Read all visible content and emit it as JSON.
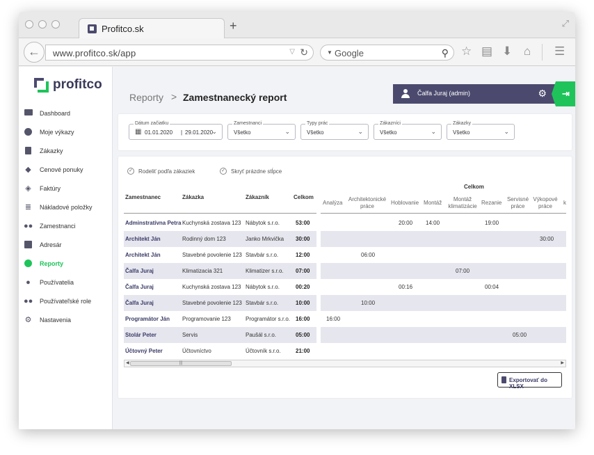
{
  "browser": {
    "tab_title": "Profitco.sk",
    "url": "www.profitco.sk/app",
    "search_placeholder": "Google"
  },
  "app": {
    "logo_text": "profitco",
    "sidebar": {
      "items": [
        {
          "label": "Dashboard",
          "icon": "dashboard-icon"
        },
        {
          "label": "Moje výkazy",
          "icon": "clock-icon"
        },
        {
          "label": "Zákazky",
          "icon": "document-icon"
        },
        {
          "label": "Cenové ponuky",
          "icon": "tag-icon"
        },
        {
          "label": "Faktúry",
          "icon": "layers-icon"
        },
        {
          "label": "Nákladové položky",
          "icon": "coins-icon"
        },
        {
          "label": "Zamestnanci",
          "icon": "users-icon"
        },
        {
          "label": "Adresár",
          "icon": "contact-book-icon"
        },
        {
          "label": "Reporty",
          "icon": "pie-chart-icon",
          "active": true
        },
        {
          "label": "Používatelia",
          "icon": "user-gear-icon"
        },
        {
          "label": "Používateľské role",
          "icon": "user-group-icon"
        },
        {
          "label": "Nastavenia",
          "icon": "gears-icon"
        }
      ]
    },
    "breadcrumb": {
      "parent": "Reporty",
      "separator": ">",
      "current": "Zamestnanecký report"
    },
    "user": {
      "name": "Čalfa Juraj (admin)"
    },
    "filters": {
      "date_label": "Dátum začiatku",
      "date_from": "01.01.2020",
      "date_to": "29.01.2020",
      "date_separator": "|",
      "employees_label": "Zamestnanci",
      "employees_value": "Všetko",
      "work_types_label": "Typy prác",
      "work_types_value": "Všetko",
      "customers_label": "Zákazníci",
      "customers_value": "Všetko",
      "orders_label": "Zákazky",
      "orders_value": "Všetko"
    },
    "options": {
      "split_by_order": "Rodeliť podľa zákaziek",
      "hide_empty": "Skryť prázdne stĺpce"
    },
    "table": {
      "headers": {
        "employee": "Zamestnanec",
        "order": "Zákazka",
        "customer": "Zákazník",
        "total": "Celkom",
        "group": "Celkom"
      },
      "work_columns": [
        "Analýza",
        "Architektonické práce",
        "Hoblovanie",
        "Montáž",
        "Montáž klimatizácie",
        "Rezanie",
        "Servisné práce",
        "Výkopové práce",
        "k"
      ],
      "rows": [
        {
          "employee": "Adminstratívna Petra",
          "order": "Kuchynská zostava 123",
          "customer": "Nábytok s.r.o.",
          "total": "53:00",
          "values": [
            "",
            "",
            "20:00",
            "14:00",
            "",
            "19:00",
            "",
            "",
            ""
          ]
        },
        {
          "employee": "Architekt Ján",
          "order": "Rodinný dom 123",
          "customer": "Janko Mrkvička",
          "total": "30:00",
          "values": [
            "",
            "",
            "",
            "",
            "",
            "",
            "",
            "30:00",
            ""
          ]
        },
        {
          "employee": "Architekt Ján",
          "order": "Stavebné povolenie 123",
          "customer": "Stavbár s.r.o.",
          "total": "12:00",
          "values": [
            "",
            "06:00",
            "",
            "",
            "",
            "",
            "",
            "",
            ""
          ]
        },
        {
          "employee": "Čalfa Juraj",
          "order": "Klimatizacia 321",
          "customer": "Klimatizer s.r.o.",
          "total": "07:00",
          "values": [
            "",
            "",
            "",
            "",
            "07:00",
            "",
            "",
            "",
            ""
          ]
        },
        {
          "employee": "Čalfa Juraj",
          "order": "Kuchynská zostava 123",
          "customer": "Nábytok s.r.o.",
          "total": "00:20",
          "values": [
            "",
            "",
            "00:16",
            "",
            "",
            "00:04",
            "",
            "",
            ""
          ]
        },
        {
          "employee": "Čalfa Juraj",
          "order": "Stavebné povolenie 123",
          "customer": "Stavbár s.r.o.",
          "total": "10:00",
          "values": [
            "",
            "10:00",
            "",
            "",
            "",
            "",
            "",
            "",
            ""
          ]
        },
        {
          "employee": "Programátor Ján",
          "order": "Programovanie 123",
          "customer": "Programátor s.r.o.",
          "total": "16:00",
          "values": [
            "16:00",
            "",
            "",
            "",
            "",
            "",
            "",
            "",
            ""
          ]
        },
        {
          "employee": "Stolár Peter",
          "order": "Servis",
          "customer": "Paušál s.r.o.",
          "total": "05:00",
          "values": [
            "",
            "",
            "",
            "",
            "",
            "",
            "05:00",
            "",
            ""
          ]
        },
        {
          "employee": "Účtovný Peter",
          "order": "Účtovníctvo",
          "customer": "Účtovník s.r.o.",
          "total": "21:00",
          "values": [
            "",
            "",
            "",
            "",
            "",
            "",
            "",
            "",
            ""
          ]
        }
      ]
    },
    "export_label": "Exportovať do XLSX"
  }
}
